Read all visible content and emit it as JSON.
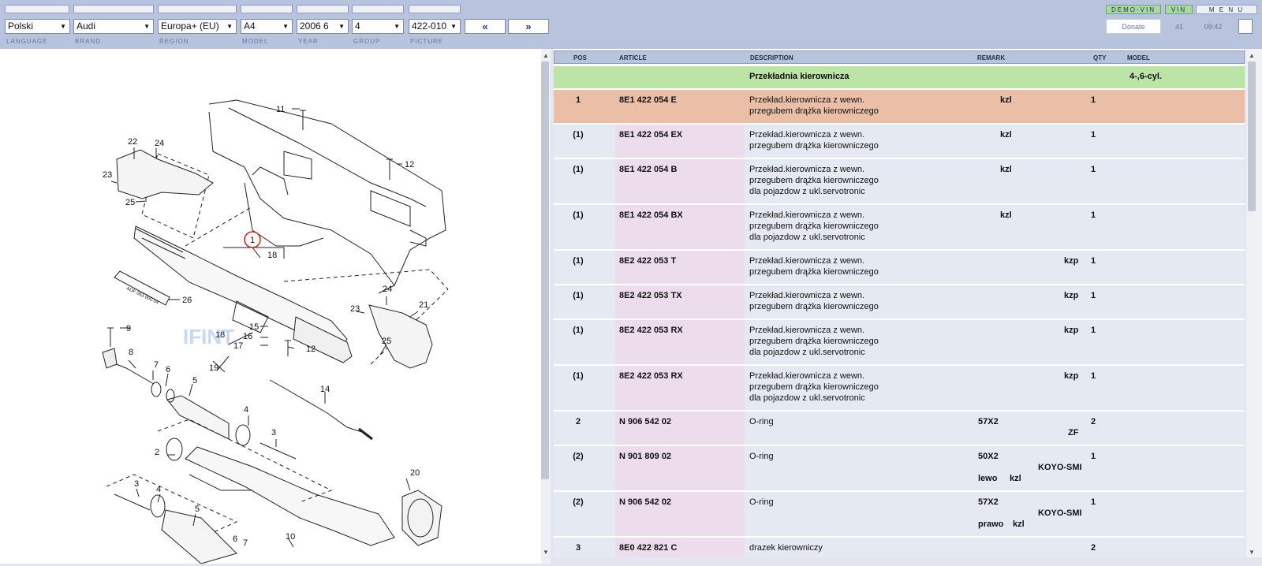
{
  "header": {
    "demo_vin": "DEMO-VIN",
    "vin": "VIN",
    "menu": "M E N U",
    "donate": "Donate",
    "counter": "41",
    "time": "09:42",
    "prev": "«",
    "next": "»"
  },
  "selectors": [
    {
      "value": "Polski",
      "label": "LANGUAGE"
    },
    {
      "value": "Audi",
      "label": "BRAND"
    },
    {
      "value": "Europa+ (EU)",
      "label": "REGION"
    },
    {
      "value": "A4",
      "label": "MODEL"
    },
    {
      "value": "2006  6",
      "label": "YEAR"
    },
    {
      "value": "4",
      "label": "GROUP"
    },
    {
      "value": "422-010",
      "label": "PICTURE"
    }
  ],
  "table": {
    "headers": {
      "pos": "POS",
      "article": "ARTICLE",
      "description": "DESCRIPTION",
      "remark": "REMARK",
      "qty": "QTY",
      "model": "MODEL"
    },
    "group_row": {
      "description": "Przekładnia kierownicza",
      "model": "4-,6-cyl."
    },
    "rows": [
      {
        "pos": "1",
        "article": "8E1 422 054 E",
        "desc": [
          "Przekład.kierownicza z wewn.",
          "przegubem drążka kierowniczego"
        ],
        "remark": [
          "kzl"
        ],
        "qty": "1"
      },
      {
        "pos": "(1)",
        "article": "8E1 422 054 EX",
        "desc": [
          "Przekład.kierownicza z wewn.",
          "przegubem drążka kierowniczego"
        ],
        "remark": [
          "kzl"
        ],
        "qty": "1"
      },
      {
        "pos": "(1)",
        "article": "8E1 422 054 B",
        "desc": [
          "Przekład.kierownicza z wewn.",
          "przegubem drążka kierowniczego",
          "dla pojazdow z ukl.servotronic"
        ],
        "remark": [
          "kzl"
        ],
        "qty": "1"
      },
      {
        "pos": "(1)",
        "article": "8E1 422 054 BX",
        "desc": [
          "Przekład.kierownicza z wewn.",
          "przegubem drążka kierowniczego",
          "dla pojazdow z ukl.servotronic"
        ],
        "remark": [
          "kzl"
        ],
        "qty": "1"
      },
      {
        "pos": "(1)",
        "article": "8E2 422 053 T",
        "desc": [
          "Przekład.kierownicza z wewn.",
          "przegubem drążka kierowniczego"
        ],
        "remark": [
          "kzp"
        ],
        "qty": "1"
      },
      {
        "pos": "(1)",
        "article": "8E2 422 053 TX",
        "desc": [
          "Przekład.kierownicza z wewn.",
          "przegubem drążka kierowniczego"
        ],
        "remark": [
          "kzp"
        ],
        "qty": "1"
      },
      {
        "pos": "(1)",
        "article": "8E2 422 053 RX",
        "desc": [
          "Przekład.kierownicza z wewn.",
          "przegubem drążka kierowniczego",
          "dla pojazdow z ukl.servotronic"
        ],
        "remark": [
          "kzp"
        ],
        "qty": "1"
      },
      {
        "pos": "(1)",
        "article": "8E2 422 053 RX",
        "desc": [
          "Przekład.kierownicza z wewn.",
          "przegubem drążka kierowniczego",
          "dla pojazdow z ukl.servotronic"
        ],
        "remark": [
          "kzp"
        ],
        "qty": "1"
      },
      {
        "pos": "2",
        "article": "N   906 542 02",
        "desc": [
          "O-ring"
        ],
        "remark": [
          "57X2",
          "ZF"
        ],
        "qty": "2"
      },
      {
        "pos": "(2)",
        "article": "N   901 809 02",
        "desc": [
          "O-ring"
        ],
        "remark": [
          "50X2",
          "KOYO-SMI",
          "lewo",
          "kzl"
        ],
        "qty": "1"
      },
      {
        "pos": "(2)",
        "article": "N   906 542 02",
        "desc": [
          "O-ring"
        ],
        "remark": [
          "57X2",
          "KOYO-SMI",
          "prawo",
          "kzl"
        ],
        "qty": "1"
      },
      {
        "pos": "3",
        "article": "8E0 422 821 C",
        "desc": [
          "drazek kierowniczy"
        ],
        "remark": [],
        "qty": "2"
      }
    ]
  },
  "diagram": {
    "callouts": [
      "11",
      "12",
      "22",
      "24",
      "23",
      "25",
      "1",
      "18",
      "26",
      "9",
      "8",
      "7",
      "6",
      "5",
      "15",
      "16",
      "17",
      "12",
      "18",
      "19",
      "24",
      "23",
      "21",
      "25",
      "14",
      "4",
      "3",
      "2",
      "20",
      "3",
      "4",
      "5",
      "6",
      "7",
      "10"
    ],
    "tube_text": "AOF 063 000 04",
    "watermark": "IFINT"
  }
}
